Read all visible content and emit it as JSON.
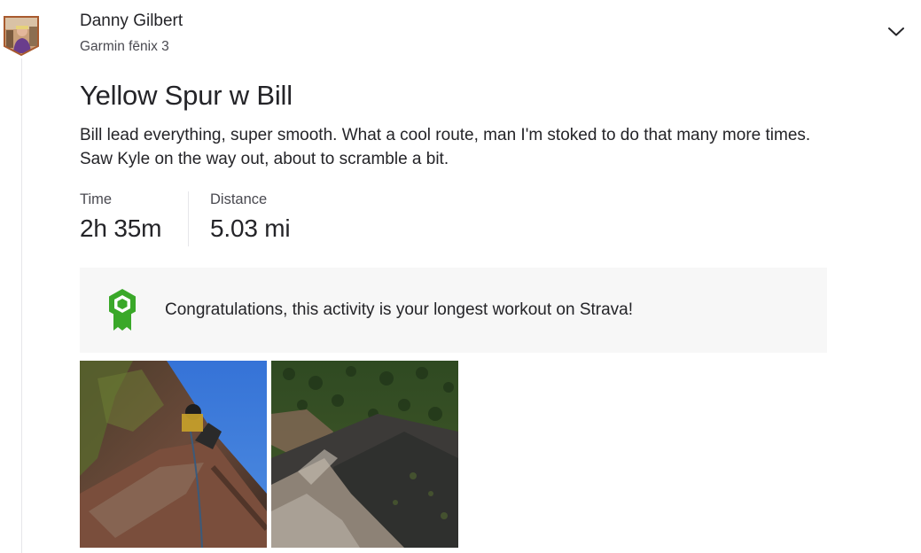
{
  "owner": {
    "name": "Danny Gilbert",
    "device": "Garmin fēnix 3"
  },
  "activity": {
    "title": "Yellow Spur w Bill",
    "description": "Bill lead everything, super smooth. What a cool route, man I'm stoked to do that many more times. Saw Kyle on the way out, about to scramble a bit."
  },
  "stats": [
    {
      "label": "Time",
      "value": "2h 35m"
    },
    {
      "label": "Distance",
      "value": "5.03 mi"
    }
  ],
  "achievement": {
    "text": "Congratulations, this activity is your longest workout on Strava!",
    "icon": "achievement-badge-icon",
    "color": "#3aa829"
  },
  "photos": [
    {
      "icon": "climbing-photo"
    },
    {
      "icon": "canyon-photo"
    }
  ],
  "colors": {
    "text": "#242428",
    "secondary_text": "#494950",
    "card_background": "#f7f7f7",
    "divider": "#e6e6ea"
  }
}
